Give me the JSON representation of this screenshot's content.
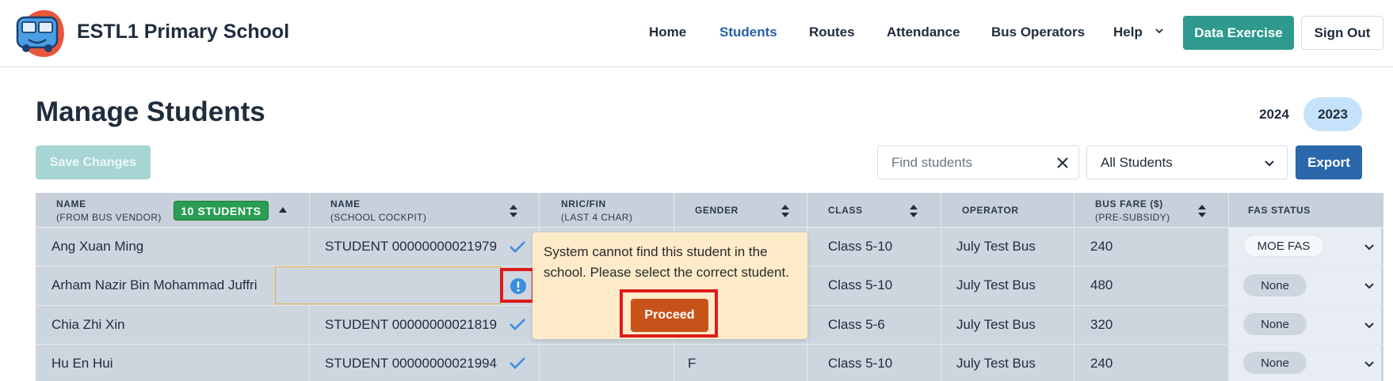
{
  "header": {
    "brand": "ESTL1 Primary School",
    "nav": [
      {
        "label": "Home",
        "active": false
      },
      {
        "label": "Students",
        "active": true
      },
      {
        "label": "Routes",
        "active": false
      },
      {
        "label": "Attendance",
        "active": false
      },
      {
        "label": "Bus Operators",
        "active": false
      },
      {
        "label": "Help",
        "active": false
      }
    ],
    "data_exercise_label": "Data Exercise",
    "sign_out_label": "Sign Out"
  },
  "page": {
    "title": "Manage Students",
    "years": [
      "2024",
      "2023"
    ],
    "selected_year": "2023"
  },
  "toolbar": {
    "save_label": "Save Changes",
    "search_placeholder": "Find students",
    "filter_value": "All Students",
    "export_label": "Export"
  },
  "table": {
    "columns": {
      "name_vendor": "Name",
      "name_vendor_sub": "(from bus vendor)",
      "students_badge": "10 STUDENTS",
      "name_school": "Name",
      "name_school_sub": "(school cockpit)",
      "nric": "NRIC/FIN",
      "nric_sub": "(last 4 char)",
      "gender": "Gender",
      "class": "Class",
      "operator": "Operator",
      "bus_fare": "Bus Fare ($)",
      "bus_fare_sub": "(pre-subsidy)",
      "fas_status": "FAS Status"
    },
    "rows": [
      {
        "vendor_name": "Ang Xuan Ming",
        "school_name": "STUDENT 00000000021979",
        "nric": "",
        "gender": "",
        "class": "Class 5-10",
        "operator": "July Test Bus",
        "fare": "240",
        "fas": "MOE FAS"
      },
      {
        "vendor_name": "Arham Nazir Bin Mohammad Juffri",
        "school_name": "",
        "nric": "",
        "gender": "",
        "class": "Class 5-10",
        "operator": "July Test Bus",
        "fare": "480",
        "fas": "None"
      },
      {
        "vendor_name": "Chia Zhi Xin",
        "school_name": "STUDENT 00000000021819",
        "nric": "",
        "gender": "",
        "class": "Class 5-6",
        "operator": "July Test Bus",
        "fare": "320",
        "fas": "None"
      },
      {
        "vendor_name": "Hu En Hui",
        "school_name": "STUDENT 00000000021994",
        "nric": "",
        "gender": "F",
        "class": "Class 5-10",
        "operator": "July Test Bus",
        "fare": "240",
        "fas": "None"
      }
    ]
  },
  "popover": {
    "message": "System cannot find this student in the school. Please select the correct student.",
    "proceed_label": "Proceed"
  },
  "icons": {
    "logo": "bus-logo-icon",
    "clear": "close-icon",
    "dropdown": "chevron-down-icon",
    "sort": "sort-icon",
    "matched": "check-icon",
    "warning": "info-icon"
  },
  "colors": {
    "accent_teal": "#2e9a8f",
    "export_blue": "#2b67ab",
    "badge_green": "#2a9d52",
    "proceed_orange": "#c8531a",
    "popover_bg": "#fdebc9",
    "highlight_red": "#e01b1b"
  }
}
